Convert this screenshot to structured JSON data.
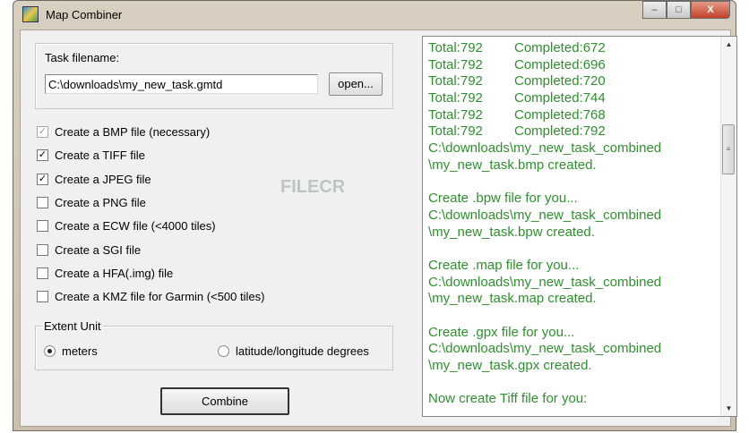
{
  "window": {
    "title": "Map Combiner",
    "minimize": "–",
    "maximize": "□",
    "close": "X"
  },
  "task": {
    "label": "Task filename:",
    "value": "C:\\downloads\\my_new_task.gmtd",
    "open_button": "open..."
  },
  "options": [
    {
      "label": "Create a BMP file (necessary)",
      "checked": true,
      "disabled": true
    },
    {
      "label": "Create a  TIFF file",
      "checked": true
    },
    {
      "label": "Create a  JPEG file",
      "checked": true
    },
    {
      "label": "Create a  PNG file",
      "checked": false
    },
    {
      "label": "Create a  ECW file  (<4000 tiles)",
      "checked": false
    },
    {
      "label": "Create a  SGI file",
      "checked": false
    },
    {
      "label": "Create a  HFA(.img) file",
      "checked": false
    },
    {
      "label": "Create a  KMZ file  for Garmin (<500 tiles)",
      "checked": false
    }
  ],
  "extent": {
    "legend": "Extent Unit",
    "meters": "meters",
    "latlon": "latitude/longitude degrees",
    "selected": "meters"
  },
  "combine_button": "Combine",
  "watermark": "FILECR",
  "log": {
    "progress": [
      {
        "total": "Total:792",
        "completed": "Completed:672"
      },
      {
        "total": "Total:792",
        "completed": "Completed:696"
      },
      {
        "total": "Total:792",
        "completed": "Completed:720"
      },
      {
        "total": "Total:792",
        "completed": "Completed:744"
      },
      {
        "total": "Total:792",
        "completed": "Completed:768"
      },
      {
        "total": "Total:792",
        "completed": "Completed:792"
      }
    ],
    "lines": [
      "C:\\downloads\\my_new_task_combined",
      "\\my_new_task.bmp created.",
      "",
      "Create .bpw file for you...",
      "C:\\downloads\\my_new_task_combined",
      "\\my_new_task.bpw created.",
      "",
      "Create .map file for you...",
      "C:\\downloads\\my_new_task_combined",
      "\\my_new_task.map created.",
      "",
      "Create .gpx file for you...",
      "C:\\downloads\\my_new_task_combined",
      "\\my_new_task.gpx created.",
      "",
      "Now create Tiff file for you:"
    ]
  }
}
